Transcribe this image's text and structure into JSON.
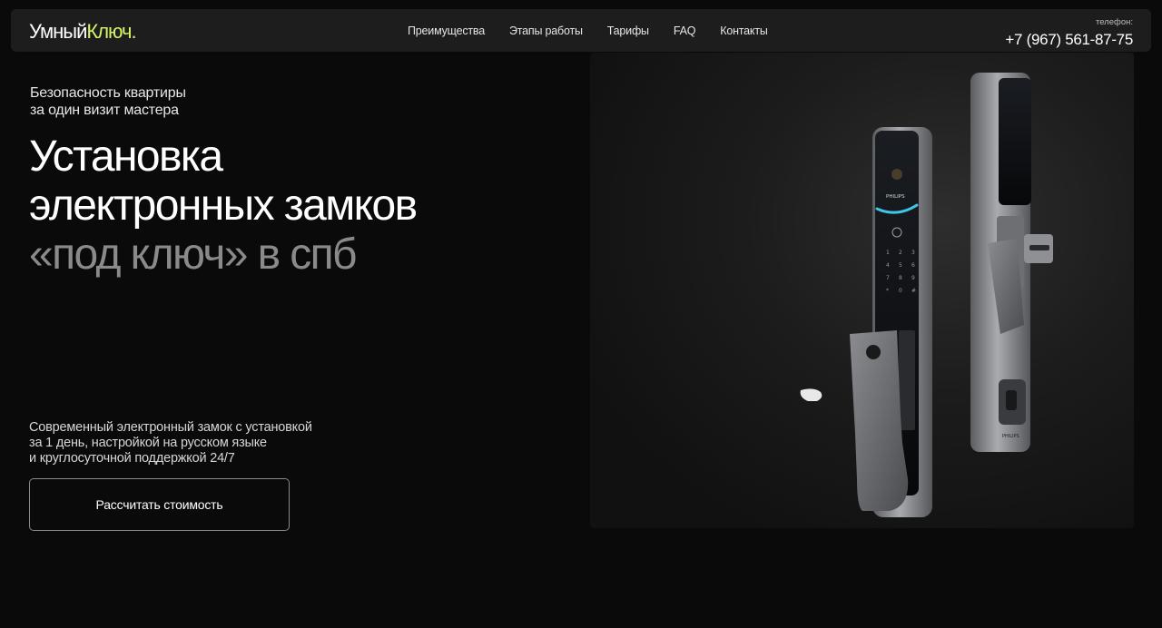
{
  "header": {
    "logo_part1": "Умный",
    "logo_part2": "Ключ.",
    "nav": [
      {
        "label": "Преимущества"
      },
      {
        "label": "Этапы работы"
      },
      {
        "label": "Тарифы"
      },
      {
        "label": "FAQ"
      },
      {
        "label": "Контакты"
      }
    ],
    "phone_label": "телефон:",
    "phone_number": "+7 (967) 561-87-75"
  },
  "hero": {
    "tagline_line1": "Безопасность квартиры",
    "tagline_line2": "за один визит мастера",
    "headline_line1": "Установка",
    "headline_line2": "электронных замков",
    "headline_line3": "«под ключ» в спб",
    "description_line1": "Современный электронный замок с установкой",
    "description_line2": "за 1 день, настройкой на русском языке",
    "description_line3": "и круглосуточной поддержкой 24/7",
    "cta_label": "Рассчитать стоимость"
  },
  "product": {
    "brand_label": "PHILIPS",
    "keypad": [
      "1",
      "2",
      "3",
      "4",
      "5",
      "6",
      "7",
      "8",
      "9",
      "*",
      "0",
      "#"
    ],
    "accent_color": "#3ec7e6",
    "logo_accent_color": "#d4f26a"
  }
}
